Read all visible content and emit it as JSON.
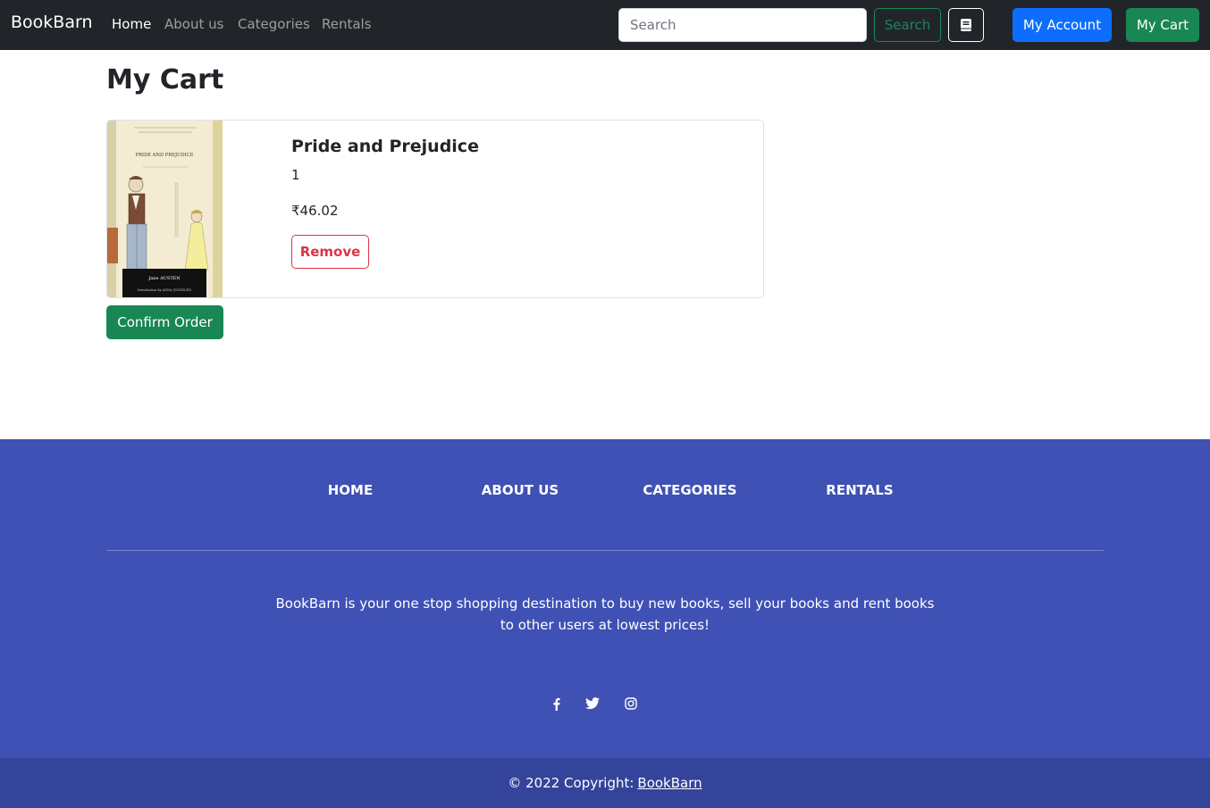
{
  "navbar": {
    "brand": "BookBarn",
    "links": [
      "Home",
      "About us",
      "Categories",
      "Rentals"
    ],
    "search_placeholder": "Search",
    "search_button": "Search",
    "account_button": "My Account",
    "cart_button": "My Cart"
  },
  "main": {
    "title": "My Cart",
    "items": [
      {
        "title": "Pride and Prejudice",
        "quantity": "1",
        "price": "₹46.02",
        "remove_label": "Remove",
        "cover": {
          "title": "PRIDE AND PREJUDICE",
          "author": "Jane AUSTEN",
          "intro": "Introduction by ANNA QUINDLEN"
        }
      }
    ],
    "confirm_label": "Confirm Order"
  },
  "footer": {
    "links": [
      "HOME",
      "ABOUT US",
      "CATEGORIES",
      "RENTALS"
    ],
    "description": "BookBarn is your one stop shopping destination to buy new books, sell your books and rent books to other users at lowest prices!",
    "social_icons": [
      "facebook-icon",
      "twitter-icon",
      "instagram-icon"
    ],
    "copyright_text": "© 2022 Copyright:",
    "copyright_link": "BookBarn"
  },
  "colors": {
    "navbar_bg": "#212529",
    "primary": "#0d6efd",
    "success": "#198754",
    "danger": "#dc3545",
    "footer_bg": "#3f51b5",
    "copyright_bg": "#34449b"
  }
}
